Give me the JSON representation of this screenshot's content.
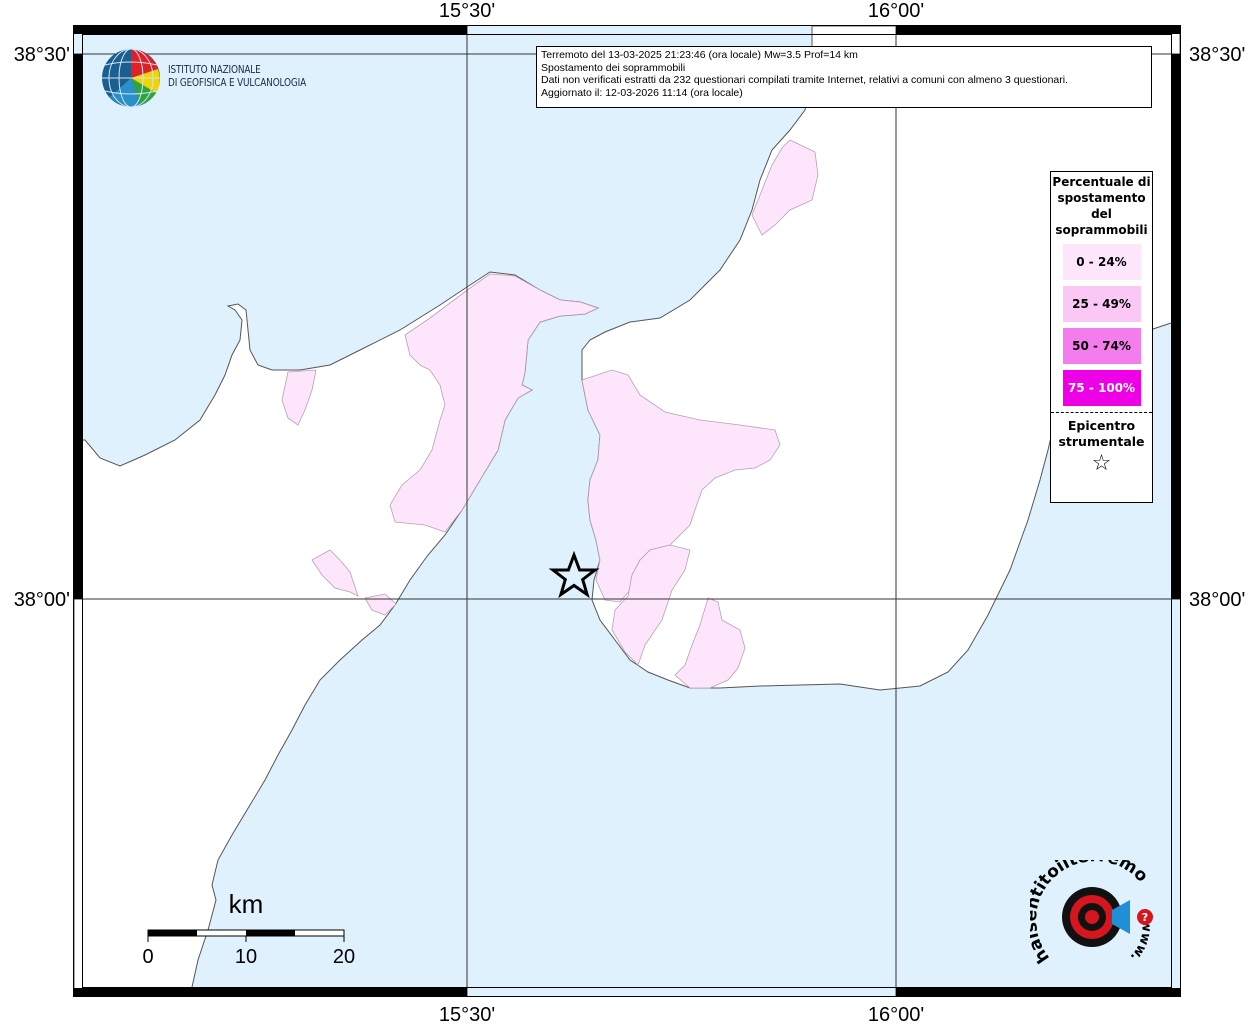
{
  "map": {
    "lon_ticks": [
      "15°30'",
      "16°00'"
    ],
    "lat_ticks": [
      "38°30'",
      "38°00'"
    ],
    "colors": {
      "sea": "#dff1fc",
      "land": "#ffffff",
      "coast": "#555555",
      "class_0_24": "#fde6fb",
      "class_25_49": "#fbc8f5",
      "class_50_74": "#f47ded",
      "class_75_100": "#ee00e6"
    }
  },
  "info": {
    "line1": "Terremoto del 13-03-2025 21:23:46 (ora locale) Mw=3.5 Prof=14 km",
    "line2": "Spostamento dei soprammobili",
    "line3": "Dati non verificati estratti da 232 questionari compilati tramite Internet, relativi a comuni con almeno 3 questionari.",
    "line4": "Aggiornato il: 12-03-2026 11:14 (ora locale)"
  },
  "legend": {
    "title": "Percentuale di spostamento del soprammobili",
    "classes": [
      {
        "label": "0 - 24%",
        "color": "#fde6fb",
        "text_color": "#000000"
      },
      {
        "label": "25 - 49%",
        "color": "#fbc8f5",
        "text_color": "#000000"
      },
      {
        "label": "50 - 74%",
        "color": "#f47ded",
        "text_color": "#000000"
      },
      {
        "label": "75 - 100%",
        "color": "#ee00e6",
        "text_color": "#ffffff"
      }
    ],
    "epicenter_label": "Epicentro strumentale",
    "epicenter_symbol": "☆"
  },
  "scale": {
    "unit": "km",
    "labels": [
      "0",
      "10",
      "20"
    ]
  },
  "logos": {
    "ingv_line1": "ISTITUTO NAZIONALE",
    "ingv_line2": "DI GEOFISICA E VULCANOLOGIA",
    "hst_main": "haisentitoilterremoto.it",
    "hst_www": "www."
  }
}
